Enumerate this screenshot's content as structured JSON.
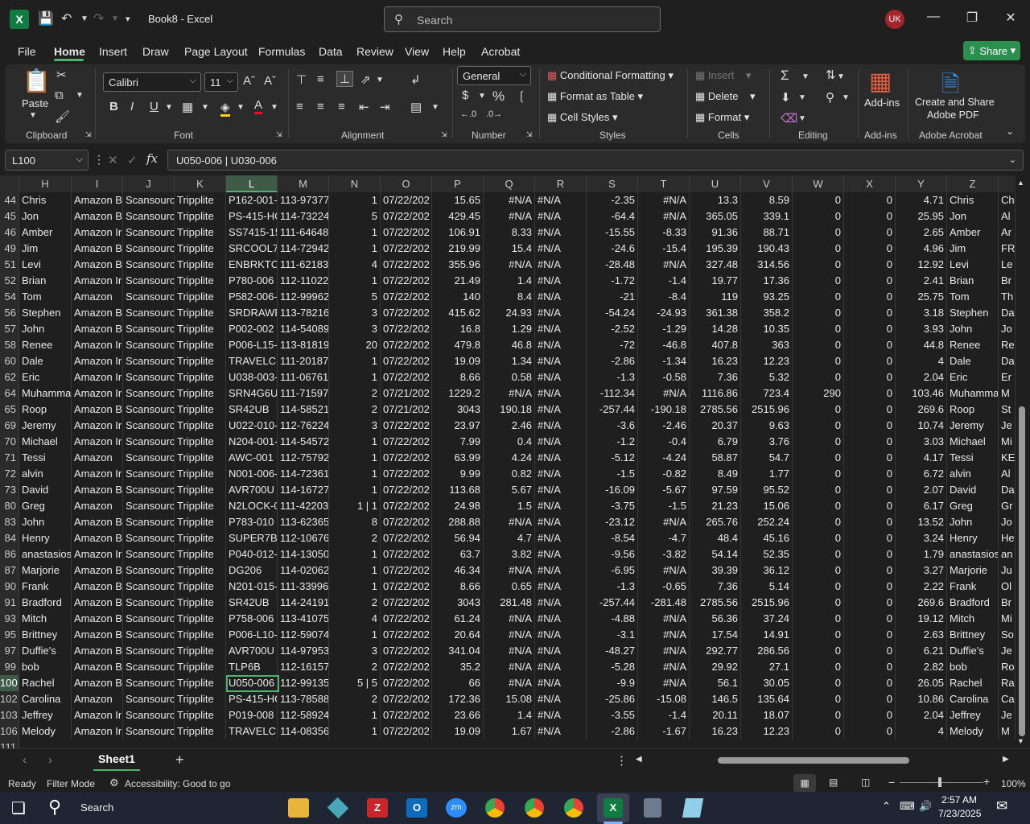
{
  "window": {
    "title": "Book8  -  Excel",
    "search_placeholder": "Search",
    "user_initials": "UK"
  },
  "menu": {
    "tabs": [
      "File",
      "Home",
      "Insert",
      "Draw",
      "Page Layout",
      "Formulas",
      "Data",
      "Review",
      "View",
      "Help",
      "Acrobat"
    ],
    "share_label": "Share"
  },
  "ribbon": {
    "clipboard": {
      "paste": "Paste",
      "group": "Clipboard"
    },
    "font": {
      "name": "Calibri",
      "size": "11",
      "group": "Font"
    },
    "alignment": {
      "group": "Alignment"
    },
    "number": {
      "format": "General",
      "group": "Number"
    },
    "styles": {
      "conditional": "Conditional Formatting",
      "table": "Format as Table",
      "cell": "Cell Styles",
      "group": "Styles"
    },
    "cells": {
      "insert": "Insert",
      "delete": "Delete",
      "format": "Format",
      "group": "Cells"
    },
    "editing": {
      "group": "Editing"
    },
    "addins": {
      "label": "Add-ins",
      "group": "Add-ins"
    },
    "acrobat": {
      "label1": "Create and Share",
      "label2": "Adobe PDF",
      "group": "Adobe Acrobat"
    }
  },
  "formula_bar": {
    "name_box": "L100",
    "formula": "U050-006 | U030-006"
  },
  "columns": [
    "H",
    "I",
    "J",
    "K",
    "L",
    "M",
    "N",
    "O",
    "P",
    "Q",
    "R",
    "S",
    "T",
    "U",
    "V",
    "W",
    "X",
    "Y",
    "Z"
  ],
  "rows": [
    [
      "44",
      "Chris",
      "Amazon B",
      "Scansourc",
      "Tripplite",
      "P162-001-",
      "113-97377",
      "1",
      "07/22/202",
      "15.65",
      "#N/A",
      "#N/A",
      "-2.35",
      "#N/A",
      "13.3",
      "8.59",
      "0",
      "0",
      "4.71",
      "Chris",
      "Ch"
    ],
    [
      "45",
      "Jon",
      "Amazon B",
      "Scansourc",
      "Tripplite",
      "PS-415-HG",
      "114-73224",
      "5",
      "07/22/202",
      "429.45",
      "#N/A",
      "#N/A",
      "-64.4",
      "#N/A",
      "365.05",
      "339.1",
      "0",
      "0",
      "25.95",
      "Jon",
      "Al"
    ],
    [
      "46",
      "Amber",
      "Amazon Ir",
      "Scansourc",
      "Tripplite",
      "SS7415-15",
      "111-64648",
      "1",
      "07/22/202",
      "106.91",
      "8.33",
      "#N/A",
      "-15.55",
      "-8.33",
      "91.36",
      "88.71",
      "0",
      "0",
      "2.65",
      "Amber",
      "Ar"
    ],
    [
      "49",
      "Jim",
      "Amazon B",
      "Scansourc",
      "Tripplite",
      "SRCOOL7K",
      "114-72942",
      "1",
      "07/22/202",
      "219.99",
      "15.4",
      "#N/A",
      "-24.6",
      "-15.4",
      "195.39",
      "190.43",
      "0",
      "0",
      "4.96",
      "Jim",
      "FR"
    ],
    [
      "51",
      "Levi",
      "Amazon B",
      "Scansourc",
      "Tripplite",
      "ENBRKTCV",
      "111-62183",
      "4",
      "07/22/202",
      "355.96",
      "#N/A",
      "#N/A",
      "-28.48",
      "#N/A",
      "327.48",
      "314.56",
      "0",
      "0",
      "12.92",
      "Levi",
      "Le"
    ],
    [
      "52",
      "Brian",
      "Amazon Ir",
      "Scansourc",
      "Tripplite",
      "P780-006",
      "112-11022",
      "1",
      "07/22/202",
      "21.49",
      "1.4",
      "#N/A",
      "-1.72",
      "-1.4",
      "19.77",
      "17.36",
      "0",
      "0",
      "2.41",
      "Brian",
      "Br"
    ],
    [
      "54",
      "Tom",
      "Amazon",
      "Scansourc",
      "Tripplite",
      "P582-006-",
      "112-99962",
      "5",
      "07/22/202",
      "140",
      "8.4",
      "#N/A",
      "-21",
      "-8.4",
      "119",
      "93.25",
      "0",
      "0",
      "25.75",
      "Tom",
      "Th"
    ],
    [
      "56",
      "Stephen",
      "Amazon B",
      "Scansourc",
      "Tripplite",
      "SRDRAWE",
      "113-78216",
      "3",
      "07/22/202",
      "415.62",
      "24.93",
      "#N/A",
      "-54.24",
      "-24.93",
      "361.38",
      "358.2",
      "0",
      "0",
      "3.18",
      "Stephen",
      "Da"
    ],
    [
      "57",
      "John",
      "Amazon B",
      "Scansourc",
      "Tripplite",
      "P002-002",
      "114-54089",
      "3",
      "07/22/202",
      "16.8",
      "1.29",
      "#N/A",
      "-2.52",
      "-1.29",
      "14.28",
      "10.35",
      "0",
      "0",
      "3.93",
      "John",
      "Jo"
    ],
    [
      "58",
      "Renee",
      "Amazon Ir",
      "Scansourc",
      "Tripplite",
      "P006-L15-",
      "113-81819",
      "20",
      "07/22/202",
      "479.8",
      "46.8",
      "#N/A",
      "-72",
      "-46.8",
      "407.8",
      "363",
      "0",
      "0",
      "44.8",
      "Renee",
      "Re"
    ],
    [
      "60",
      "Dale",
      "Amazon Ir",
      "Scansourc",
      "Tripplite",
      "TRAVELCU",
      "111-20187",
      "1",
      "07/22/202",
      "19.09",
      "1.34",
      "#N/A",
      "-2.86",
      "-1.34",
      "16.23",
      "12.23",
      "0",
      "0",
      "4",
      "Dale",
      "Da"
    ],
    [
      "62",
      "Eric",
      "Amazon Ir",
      "Scansourc",
      "Tripplite",
      "U038-003-",
      "111-06761",
      "1",
      "07/22/202",
      "8.66",
      "0.58",
      "#N/A",
      "-1.3",
      "-0.58",
      "7.36",
      "5.32",
      "0",
      "0",
      "2.04",
      "Eric",
      "Er"
    ],
    [
      "64",
      "Muhamma",
      "Amazon Ir",
      "Scansourc",
      "Tripplite",
      "SRN4G6U",
      "111-71597",
      "2",
      "07/21/202",
      "1229.2",
      "#N/A",
      "#N/A",
      "-112.34",
      "#N/A",
      "1116.86",
      "723.4",
      "290",
      "0",
      "103.46",
      "Muhamma",
      "M"
    ],
    [
      "65",
      "Roop",
      "Amazon B",
      "Scansourc",
      "Tripplite",
      "SR42UB",
      "114-58521",
      "2",
      "07/21/202",
      "3043",
      "190.18",
      "#N/A",
      "-257.44",
      "-190.18",
      "2785.56",
      "2515.96",
      "0",
      "0",
      "269.6",
      "Roop",
      "St"
    ],
    [
      "69",
      "Jeremy",
      "Amazon Ir",
      "Scansourc",
      "Tripplite",
      "U022-010-",
      "112-76224",
      "3",
      "07/22/202",
      "23.97",
      "2.46",
      "#N/A",
      "-3.6",
      "-2.46",
      "20.37",
      "9.63",
      "0",
      "0",
      "10.74",
      "Jeremy",
      "Je"
    ],
    [
      "70",
      "Michael",
      "Amazon Ir",
      "Scansourc",
      "Tripplite",
      "N204-001-",
      "114-54572",
      "1",
      "07/22/202",
      "7.99",
      "0.4",
      "#N/A",
      "-1.2",
      "-0.4",
      "6.79",
      "3.76",
      "0",
      "0",
      "3.03",
      "Michael",
      "Mi"
    ],
    [
      "71",
      "Tessi",
      "Amazon",
      "Scansourc",
      "Tripplite",
      "AWC-001",
      "112-75792",
      "1",
      "07/22/202",
      "63.99",
      "4.24",
      "#N/A",
      "-5.12",
      "-4.24",
      "58.87",
      "54.7",
      "0",
      "0",
      "4.17",
      "Tessi",
      "KE"
    ],
    [
      "72",
      "alvin",
      "Amazon Ir",
      "Scansourc",
      "Tripplite",
      "N001-006-",
      "114-72361",
      "1",
      "07/22/202",
      "9.99",
      "0.82",
      "#N/A",
      "-1.5",
      "-0.82",
      "8.49",
      "1.77",
      "0",
      "0",
      "6.72",
      "alvin",
      "Al"
    ],
    [
      "73",
      "David",
      "Amazon B",
      "Scansourc",
      "Tripplite",
      "AVR700U",
      "114-16727",
      "1",
      "07/22/202",
      "113.68",
      "5.67",
      "#N/A",
      "-16.09",
      "-5.67",
      "97.59",
      "95.52",
      "0",
      "0",
      "2.07",
      "David",
      "Da"
    ],
    [
      "80",
      "Greg",
      "Amazon",
      "Scansourc",
      "Tripplite",
      "N2LOCK-0",
      "111-42203",
      "1 | 1",
      "07/22/202",
      "24.98",
      "1.5",
      "#N/A",
      "-3.75",
      "-1.5",
      "21.23",
      "15.06",
      "0",
      "0",
      "6.17",
      "Greg",
      "Gr"
    ],
    [
      "83",
      "John",
      "Amazon B",
      "Scansourc",
      "Tripplite",
      "P783-010",
      "113-62365",
      "8",
      "07/22/202",
      "288.88",
      "#N/A",
      "#N/A",
      "-23.12",
      "#N/A",
      "265.76",
      "252.24",
      "0",
      "0",
      "13.52",
      "John",
      "Jo"
    ],
    [
      "84",
      "Henry",
      "Amazon B",
      "Scansourc",
      "Tripplite",
      "SUPER7B",
      "112-10676",
      "2",
      "07/22/202",
      "56.94",
      "4.7",
      "#N/A",
      "-8.54",
      "-4.7",
      "48.4",
      "45.16",
      "0",
      "0",
      "3.24",
      "Henry",
      "He"
    ],
    [
      "86",
      "anastasios",
      "Amazon Ir",
      "Scansourc",
      "Tripplite",
      "P040-012-",
      "114-13050",
      "1",
      "07/22/202",
      "63.7",
      "3.82",
      "#N/A",
      "-9.56",
      "-3.82",
      "54.14",
      "52.35",
      "0",
      "0",
      "1.79",
      "anastasios",
      "an"
    ],
    [
      "87",
      "Marjorie",
      "Amazon B",
      "Scansourc",
      "Tripplite",
      "DG206",
      "114-02062",
      "1",
      "07/22/202",
      "46.34",
      "#N/A",
      "#N/A",
      "-6.95",
      "#N/A",
      "39.39",
      "36.12",
      "0",
      "0",
      "3.27",
      "Marjorie",
      "Ju"
    ],
    [
      "90",
      "Frank",
      "Amazon B",
      "Scansourc",
      "Tripplite",
      "N201-015-",
      "111-33996",
      "1",
      "07/22/202",
      "8.66",
      "0.65",
      "#N/A",
      "-1.3",
      "-0.65",
      "7.36",
      "5.14",
      "0",
      "0",
      "2.22",
      "Frank",
      "Ol"
    ],
    [
      "91",
      "Bradford",
      "Amazon B",
      "Scansourc",
      "Tripplite",
      "SR42UB",
      "114-24191",
      "2",
      "07/22/202",
      "3043",
      "281.48",
      "#N/A",
      "-257.44",
      "-281.48",
      "2785.56",
      "2515.96",
      "0",
      "0",
      "269.6",
      "Bradford",
      "Br"
    ],
    [
      "93",
      "Mitch",
      "Amazon B",
      "Scansourc",
      "Tripplite",
      "P758-006",
      "113-41075",
      "4",
      "07/22/202",
      "61.24",
      "#N/A",
      "#N/A",
      "-4.88",
      "#N/A",
      "56.36",
      "37.24",
      "0",
      "0",
      "19.12",
      "Mitch",
      "Mi"
    ],
    [
      "95",
      "Brittney",
      "Amazon B",
      "Scansourc",
      "Tripplite",
      "P006-L10-",
      "112-59074",
      "1",
      "07/22/202",
      "20.64",
      "#N/A",
      "#N/A",
      "-3.1",
      "#N/A",
      "17.54",
      "14.91",
      "0",
      "0",
      "2.63",
      "Brittney",
      "So"
    ],
    [
      "97",
      "Duffie's",
      "Amazon B",
      "Scansourc",
      "Tripplite",
      "AVR700U",
      "114-97953",
      "3",
      "07/22/202",
      "341.04",
      "#N/A",
      "#N/A",
      "-48.27",
      "#N/A",
      "292.77",
      "286.56",
      "0",
      "0",
      "6.21",
      "Duffie's",
      "Je"
    ],
    [
      "99",
      "bob",
      "Amazon B",
      "Scansourc",
      "Tripplite",
      "TLP6B",
      "112-16157",
      "2",
      "07/22/202",
      "35.2",
      "#N/A",
      "#N/A",
      "-5.28",
      "#N/A",
      "29.92",
      "27.1",
      "0",
      "0",
      "2.82",
      "bob",
      "Ro"
    ],
    [
      "100",
      "Rachel",
      "Amazon B",
      "Scansourc",
      "Tripplite",
      "U050-006",
      "112-99135",
      "5 | 5",
      "07/22/202",
      "66",
      "#N/A",
      "#N/A",
      "-9.9",
      "#N/A",
      "56.1",
      "30.05",
      "0",
      "0",
      "26.05",
      "Rachel",
      "Ra"
    ],
    [
      "102",
      "Carolina",
      "Amazon",
      "Scansourc",
      "Tripplite",
      "PS-415-HG",
      "113-78588",
      "2",
      "07/22/202",
      "172.36",
      "15.08",
      "#N/A",
      "-25.86",
      "-15.08",
      "146.5",
      "135.64",
      "0",
      "0",
      "10.86",
      "Carolina",
      "Ca"
    ],
    [
      "103",
      "Jeffrey",
      "Amazon Ir",
      "Scansourc",
      "Tripplite",
      "P019-008",
      "112-58924",
      "1",
      "07/22/202",
      "23.66",
      "1.4",
      "#N/A",
      "-3.55",
      "-1.4",
      "20.11",
      "18.07",
      "0",
      "0",
      "2.04",
      "Jeffrey",
      "Je"
    ],
    [
      "106",
      "Melody",
      "Amazon Ir",
      "Scansourc",
      "Tripplite",
      "TRAVELCU",
      "114-08356",
      "1",
      "07/22/202",
      "19.09",
      "1.67",
      "#N/A",
      "-2.86",
      "-1.67",
      "16.23",
      "12.23",
      "0",
      "0",
      "4",
      "Melody",
      "M"
    ]
  ],
  "partial_row": "111",
  "sheet": {
    "name": "Sheet1"
  },
  "status": {
    "ready": "Ready",
    "filter": "Filter Mode",
    "accessibility": "Accessibility: Good to go",
    "zoom": "100%"
  },
  "taskbar": {
    "search": "Search",
    "time": "2:57 AM",
    "date": "7/23/2025"
  },
  "colors": {
    "accent": "#4fb36f",
    "excel": "#107c41"
  }
}
